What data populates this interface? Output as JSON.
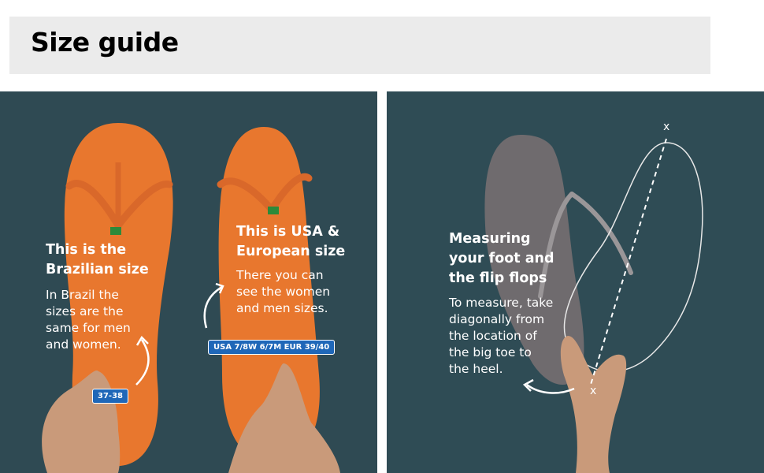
{
  "page": {
    "title": "Size guide"
  },
  "left_panel": {
    "brazil": {
      "heading": [
        "This is the",
        "Brazilian size"
      ],
      "body": [
        "In Brazil the",
        "sizes are the",
        "same for men",
        "and women."
      ],
      "badge": "37-38"
    },
    "usa": {
      "heading": [
        "This is USA &",
        "European size"
      ],
      "body": [
        "There you can",
        "see the women",
        "and men sizes."
      ],
      "badge": "USA 7/8W 6/7M EUR 39/40"
    }
  },
  "right_panel": {
    "heading": [
      "Measuring",
      "your foot and",
      "the flip flops"
    ],
    "body": [
      "To measure, take",
      "diagonally from",
      "the location of",
      "the big toe to",
      "the heel."
    ],
    "marker_top": "x",
    "marker_bottom": "x"
  },
  "colors": {
    "panel_bg": "#2f4a53",
    "sandal_orange": "#e8772e",
    "sandal_grey": "#6f6b6e",
    "badge_blue": "#1f67b8",
    "header_bg": "#ebebeb"
  }
}
